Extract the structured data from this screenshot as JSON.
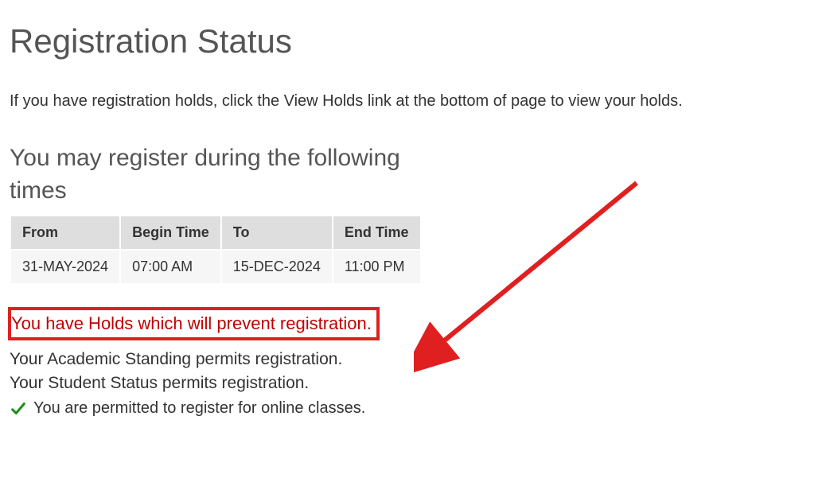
{
  "page": {
    "title": "Registration Status",
    "intro": "If you have registration holds, click the View Holds link at the bottom of page to view your holds.",
    "sub_heading": "You may register during the following times"
  },
  "table": {
    "headers": {
      "from": "From",
      "begin_time": "Begin Time",
      "to": "To",
      "end_time": "End Time"
    },
    "row": {
      "from": "31-MAY-2024",
      "begin_time": "07:00 AM",
      "to": "15-DEC-2024",
      "end_time": "11:00 PM"
    }
  },
  "status": {
    "holds_alert": "You have Holds which will prevent registration.",
    "academic_standing": "Your Academic Standing permits registration.",
    "student_status": "Your Student Status permits registration.",
    "online_permit": "You are permitted to register for online classes."
  },
  "colors": {
    "alert_red": "#c00000",
    "border_red": "#e02020",
    "check_green": "#2e9c2e"
  }
}
